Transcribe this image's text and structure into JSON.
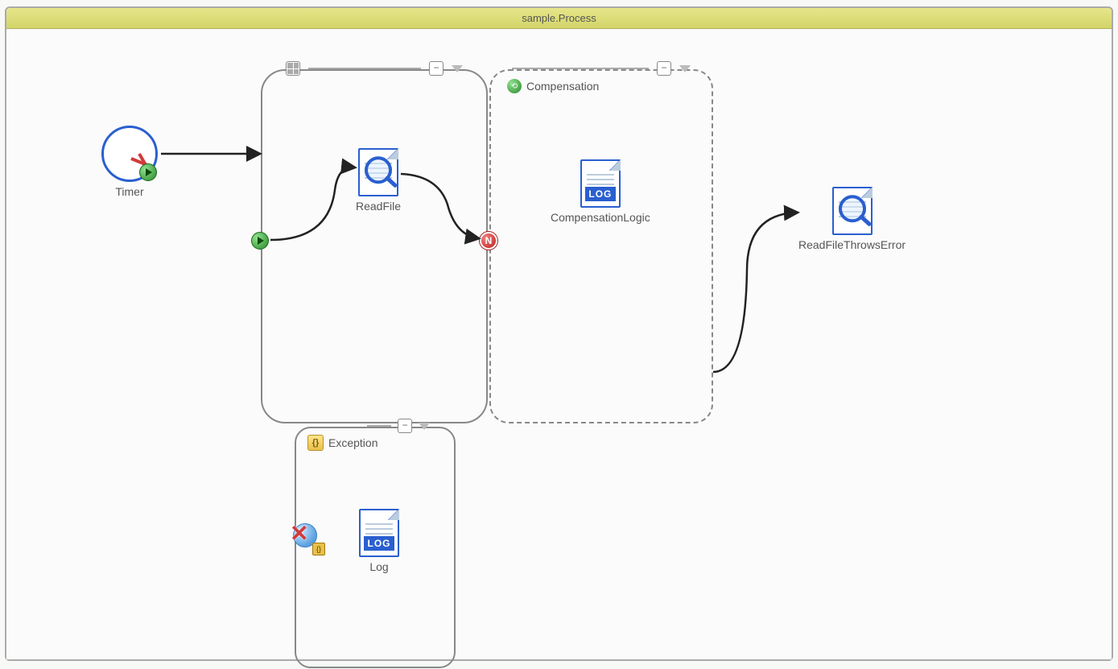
{
  "process": {
    "title": "sample.Process"
  },
  "activities": {
    "timer": {
      "label": "Timer"
    },
    "readfile": {
      "label": "ReadFile"
    },
    "complogic": {
      "label": "CompensationLogic",
      "log_text": "LOG"
    },
    "readfile_err": {
      "label": "ReadFileThrowsError"
    },
    "log": {
      "label": "Log",
      "log_text": "LOG"
    }
  },
  "scopes": {
    "compensation": {
      "label": "Compensation"
    },
    "exception": {
      "label": "Exception"
    }
  },
  "toolbar": {
    "collapse_symbol": "−"
  }
}
